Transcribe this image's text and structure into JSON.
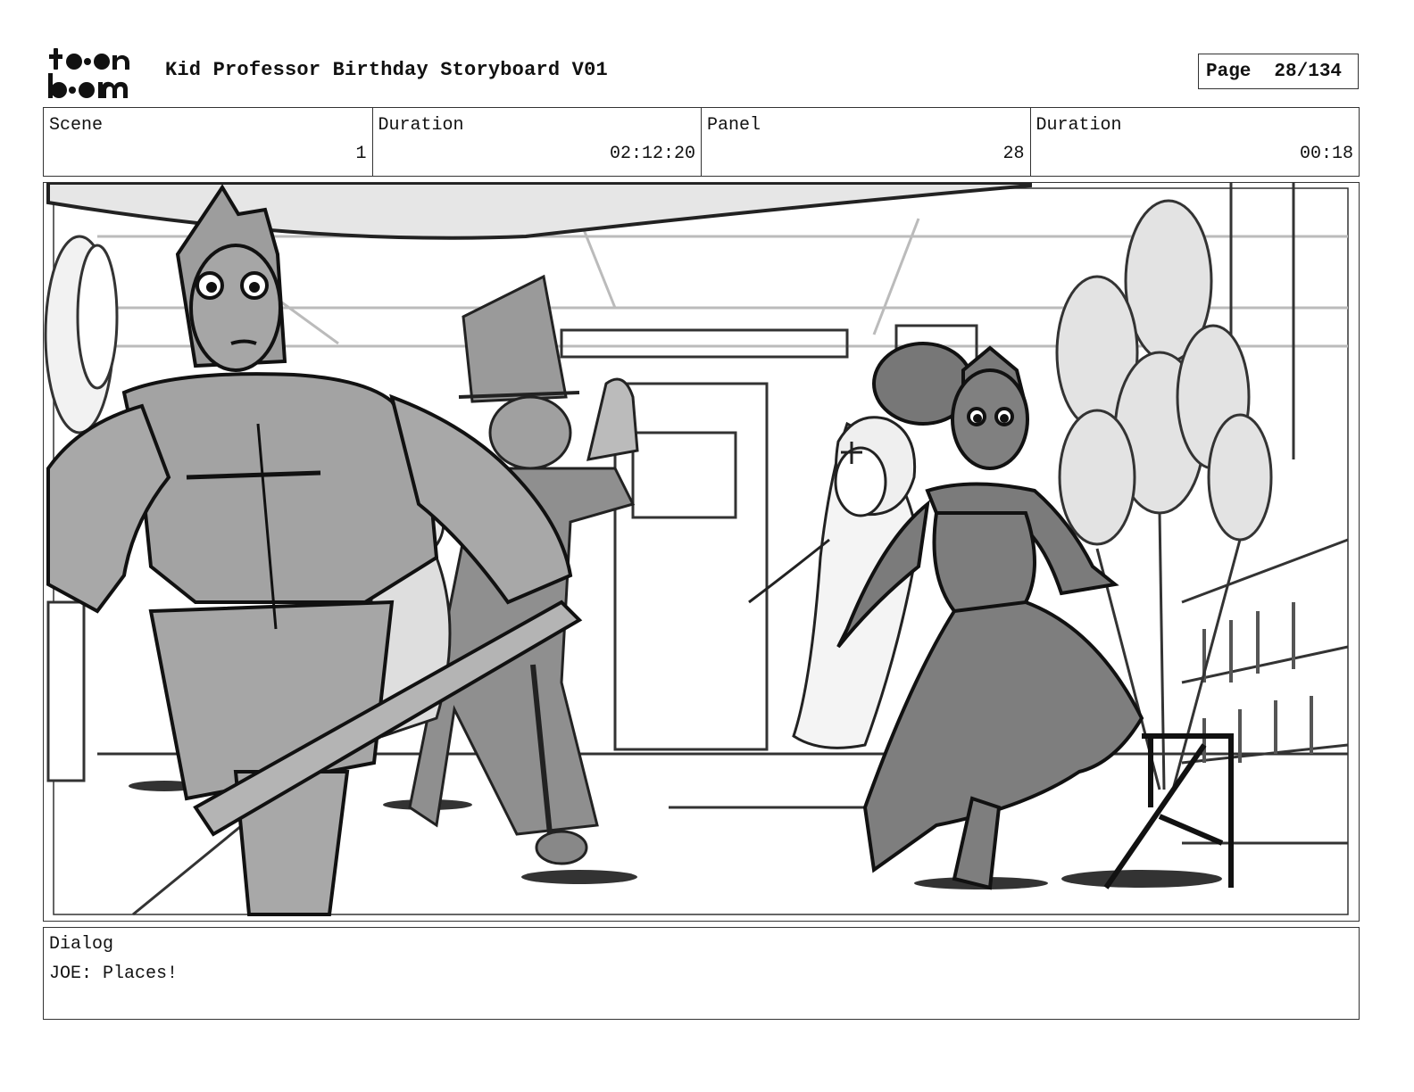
{
  "header": {
    "logo_text": "toon boom",
    "title": "Kid Professor Birthday Storyboard V01",
    "page_label": "Page",
    "page_value": "28/134"
  },
  "info": {
    "scene_label": "Scene",
    "scene_value": "1",
    "scene_duration_label": "Duration",
    "scene_duration_value": "02:12:20",
    "panel_label": "Panel",
    "panel_value": "28",
    "panel_duration_label": "Duration",
    "panel_duration_value": "00:18"
  },
  "panel": {
    "icon": "storyboard-sketch-image"
  },
  "dialog": {
    "label": "Dialog",
    "text": "JOE: Places!"
  }
}
